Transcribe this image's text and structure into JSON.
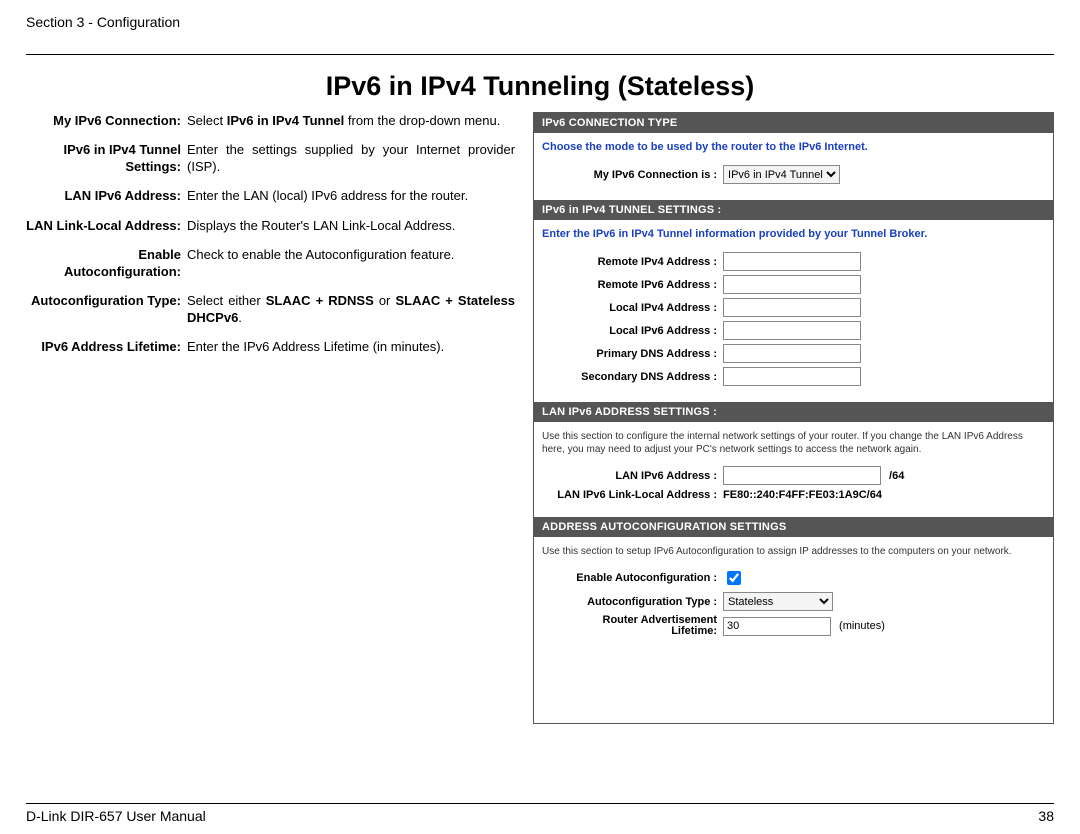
{
  "header": {
    "section_label": "Section 3 - Configuration"
  },
  "title": "IPv6 in IPv4 Tunneling (Stateless)",
  "defs": [
    {
      "term": "My IPv6 Connection:",
      "desc_html": "Select <b>IPv6 in IPv4 Tunnel</b> from the drop-down menu."
    },
    {
      "term": "IPv6 in IPv4 Tunnel Settings:",
      "desc_html": "Enter the settings supplied by your Internet provider (ISP)."
    },
    {
      "term": "LAN IPv6 Address:",
      "desc_html": "Enter the LAN (local) IPv6 address for the router."
    },
    {
      "term": "LAN Link-Local Address:",
      "desc_html": "Displays the Router's LAN Link-Local Address."
    },
    {
      "term": "Enable Autoconfiguration:",
      "desc_html": "Check to enable the Autoconfiguration feature."
    },
    {
      "term": "Autoconfiguration Type:",
      "desc_html": "Select either <b>SLAAC + RDNSS</b> or <b>SLAAC + Stateless DHCPv6</b>."
    },
    {
      "term": "IPv6 Address Lifetime:",
      "desc_html": "Enter the IPv6 Address Lifetime (in minutes)."
    }
  ],
  "panel": {
    "sec1": {
      "header": "IPv6 CONNECTION TYPE",
      "note": "Choose the mode to be used by the router to the IPv6 Internet.",
      "row": {
        "label": "My IPv6 Connection is :",
        "select_value": "IPv6 in IPv4 Tunnel"
      }
    },
    "sec2": {
      "header": "IPv6 in IPv4 TUNNEL SETTINGS :",
      "note": "Enter the IPv6 in IPv4 Tunnel information provided by your Tunnel Broker.",
      "rows": [
        "Remote IPv4 Address :",
        "Remote IPv6 Address :",
        "Local IPv4 Address :",
        "Local IPv6 Address :",
        "Primary DNS Address :",
        "Secondary DNS Address :"
      ]
    },
    "sec3": {
      "header": "LAN IPv6 ADDRESS SETTINGS :",
      "note": "Use this section to configure the internal network settings of your router. If you change the LAN IPv6 Address here, you may need to adjust your PC's network settings to access the network again.",
      "row1_label": "LAN IPv6 Address :",
      "row1_suffix": "/64",
      "row2_label": "LAN IPv6 Link-Local Address :",
      "row2_value": "FE80::240:F4FF:FE03:1A9C/64"
    },
    "sec4": {
      "header": "ADDRESS AUTOCONFIGURATION SETTINGS",
      "note": "Use this section to setup IPv6 Autoconfiguration to assign IP addresses to the computers on your network.",
      "row1_label": "Enable Autoconfiguration :",
      "row2_label": "Autoconfiguration Type :",
      "row2_value": "Stateless",
      "row3_label_a": "Router Advertisement",
      "row3_label_b": "Lifetime:",
      "row3_value": "30",
      "row3_unit": "(minutes)"
    }
  },
  "footer": {
    "left": "D-Link DIR-657 User Manual",
    "right": "38"
  }
}
